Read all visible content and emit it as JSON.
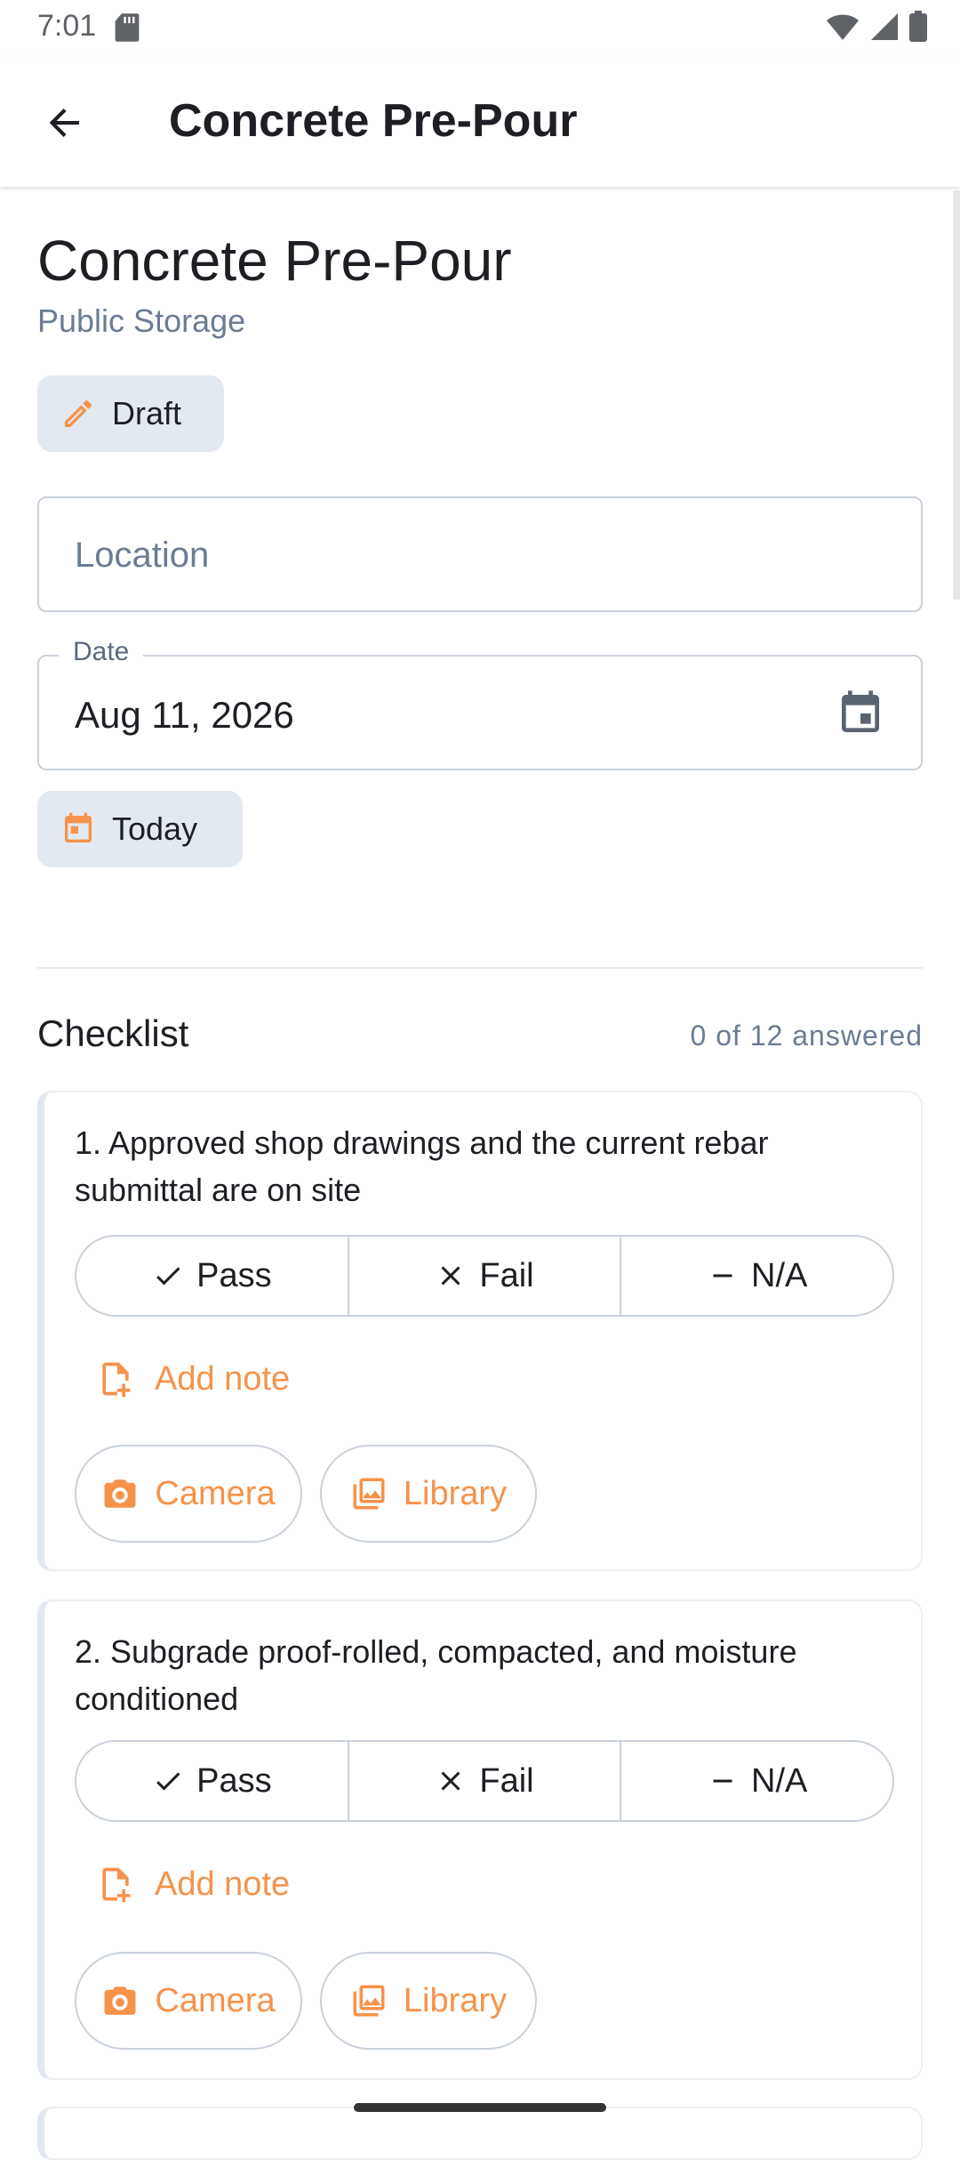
{
  "status_bar": {
    "time": "7:01"
  },
  "app_bar": {
    "title": "Concrete Pre-Pour"
  },
  "header": {
    "title": "Concrete Pre-Pour",
    "subtitle": "Public Storage"
  },
  "status_chip": {
    "label": "Draft"
  },
  "location": {
    "placeholder": "Location",
    "value": ""
  },
  "date": {
    "label": "Date",
    "value": "Aug 11, 2026"
  },
  "today_button": {
    "label": "Today"
  },
  "checklist": {
    "title": "Checklist",
    "count_text": "0 of 12 answered",
    "items": [
      {
        "question": "1. Approved shop drawings and the current rebar submittal are on site",
        "pass_label": "Pass",
        "fail_label": "Fail",
        "na_label": "N/A",
        "add_note_label": "Add note",
        "camera_label": "Camera",
        "library_label": "Library"
      },
      {
        "question": "2. Subgrade proof-rolled, compacted, and moisture conditioned",
        "pass_label": "Pass",
        "fail_label": "Fail",
        "na_label": "N/A",
        "add_note_label": "Add note",
        "camera_label": "Camera",
        "library_label": "Library"
      }
    ]
  },
  "colors": {
    "accent": "#f7924a",
    "chip_bg": "#e3e9f0",
    "border": "#c9d1dc",
    "muted_text": "#6b7c93"
  }
}
